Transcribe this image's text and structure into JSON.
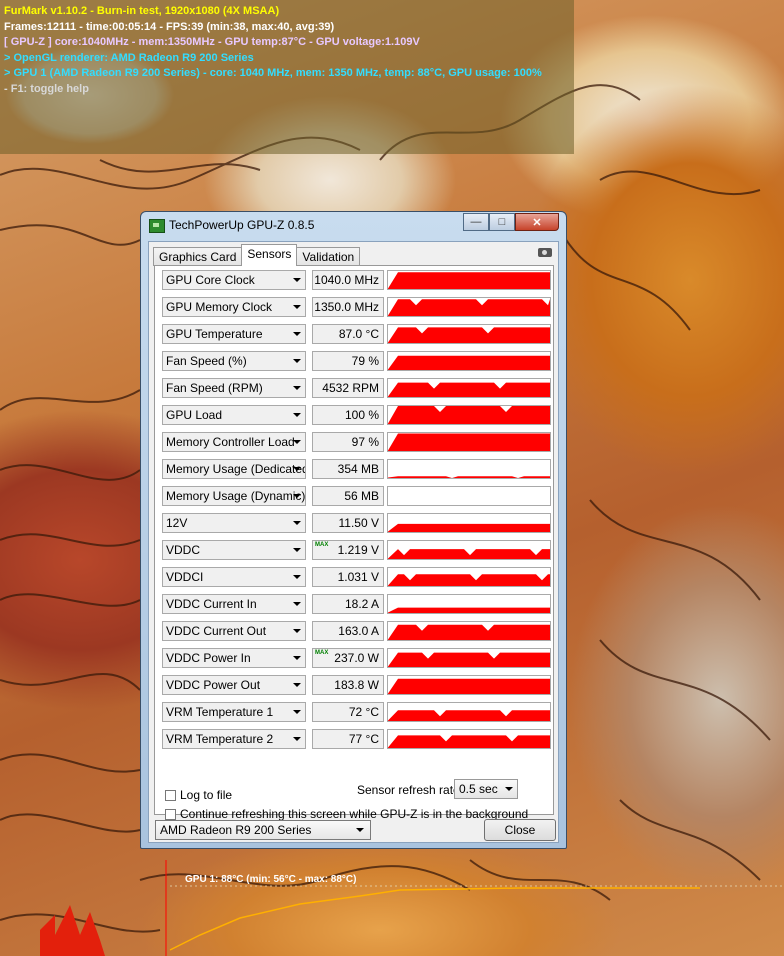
{
  "furmark": {
    "title": "FurMark v1.10.2 - Burn-in test, 1920x1080 (4X MSAA)",
    "frames": "Frames:12111 - time:00:05:14 - FPS:39 (min:38, max:40, avg:39)",
    "gpuz": "[ GPU-Z ] core:1040MHz - mem:1350MHz - GPU temp:87°C - GPU voltage:1.109V",
    "renderer": "> OpenGL renderer: AMD Radeon R9 200 Series",
    "gpu1": "> GPU 1 (AMD Radeon R9 200 Series) - core: 1040 MHz, mem: 1350 MHz, temp: 88°C, GPU usage: 100%",
    "help": "- F1: toggle help",
    "temp_graph_label": "GPU 1: 88°C (min: 56°C - max: 88°C)"
  },
  "window": {
    "title": "TechPowerUp GPU-Z 0.8.5",
    "minimize": "—",
    "maximize": "□",
    "close": "✕"
  },
  "tabs": [
    {
      "label": "Graphics Card",
      "active": false
    },
    {
      "label": "Sensors",
      "active": true
    },
    {
      "label": "Validation",
      "active": false
    }
  ],
  "sensors": [
    {
      "label": "GPU Core Clock",
      "value": "1040.0 MHz",
      "level": 0.93,
      "max": false
    },
    {
      "label": "GPU Memory Clock",
      "value": "1350.0 MHz",
      "level": 0.93,
      "max": false
    },
    {
      "label": "GPU Temperature",
      "value": "87.0 °C",
      "level": 0.87,
      "max": false
    },
    {
      "label": "Fan Speed (%)",
      "value": "79 %",
      "level": 0.79,
      "max": false
    },
    {
      "label": "Fan Speed (RPM)",
      "value": "4532 RPM",
      "level": 0.8,
      "max": false
    },
    {
      "label": "GPU Load",
      "value": "100 %",
      "level": 1.0,
      "max": false
    },
    {
      "label": "Memory Controller Load",
      "value": "97 %",
      "level": 0.97,
      "max": false
    },
    {
      "label": "Memory Usage (Dedicated)",
      "value": "354 MB",
      "level": 0.1,
      "max": false
    },
    {
      "label": "Memory Usage (Dynamic)",
      "value": "56 MB",
      "level": 0.0,
      "max": false
    },
    {
      "label": "12V",
      "value": "11.50 V",
      "level": 0.45,
      "max": false
    },
    {
      "label": "VDDC",
      "value": "1.219 V",
      "level": 0.55,
      "max": true
    },
    {
      "label": "VDDCI",
      "value": "1.031 V",
      "level": 0.65,
      "max": false
    },
    {
      "label": "VDDC Current In",
      "value": "18.2 A",
      "level": 0.3,
      "max": false
    },
    {
      "label": "VDDC Current Out",
      "value": "163.0 A",
      "level": 0.85,
      "max": false
    },
    {
      "label": "VDDC Power In",
      "value": "237.0 W",
      "level": 0.8,
      "max": true
    },
    {
      "label": "VDDC Power Out",
      "value": "183.8 W",
      "level": 0.85,
      "max": false
    },
    {
      "label": "VRM Temperature 1",
      "value": "72 °C",
      "level": 0.6,
      "max": false
    },
    {
      "label": "VRM Temperature 2",
      "value": "77 °C",
      "level": 0.7,
      "max": false
    }
  ],
  "max_tag": "MAX",
  "log_to_file": "Log to file",
  "continue_refresh": "Continue refreshing this screen while GPU-Z is in the background",
  "refresh_rate_label": "Sensor refresh rate:",
  "refresh_rate_value": "0.5 sec",
  "gpu_select": "AMD Radeon R9 200 Series",
  "close_button": "Close",
  "colors": {
    "graph": "#ff0000",
    "hud_yellow": "#ffff00",
    "hud_cyan": "#33ddff"
  }
}
